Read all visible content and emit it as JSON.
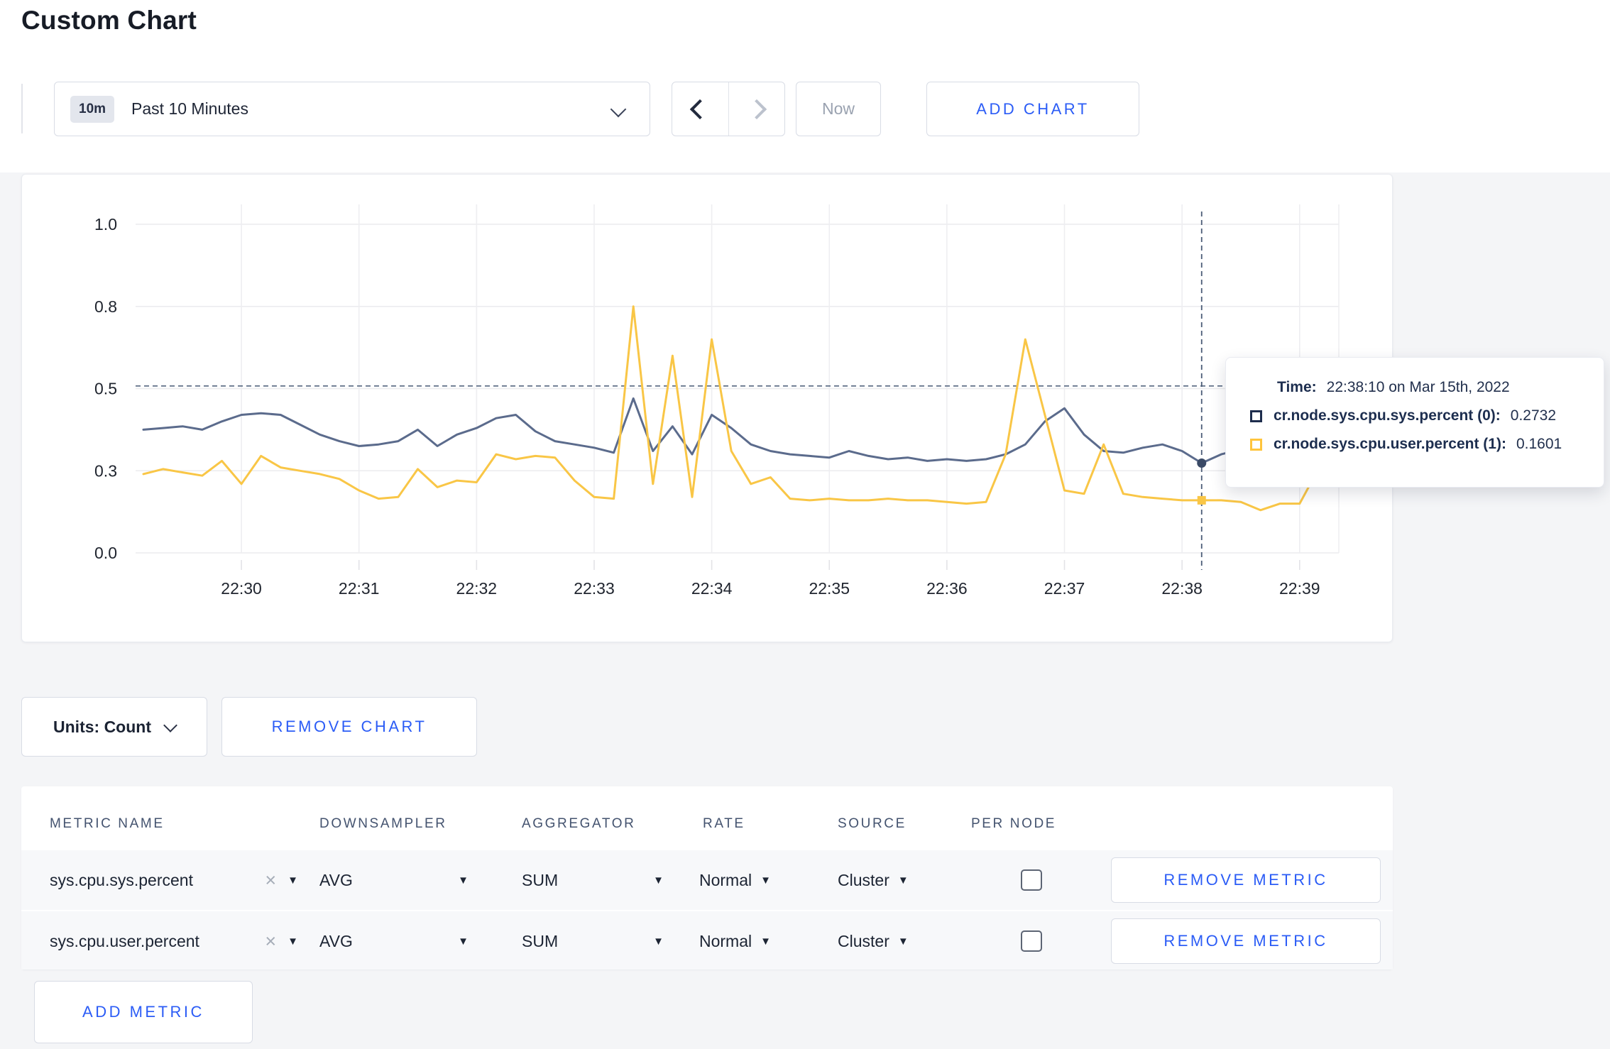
{
  "page": {
    "title": "Custom Chart"
  },
  "toolbar": {
    "time_window_badge": "10m",
    "time_window_label": "Past 10 Minutes",
    "now_label": "Now",
    "add_chart_label": "ADD CHART"
  },
  "chart_controls": {
    "units_label": "Units: Count",
    "remove_chart_label": "REMOVE CHART",
    "add_metric_label": "ADD METRIC"
  },
  "tooltip": {
    "time_label": "Time:",
    "time_value": "22:38:10 on Mar 15th, 2022",
    "series": [
      {
        "label": "cr.node.sys.cpu.sys.percent (0):",
        "value": "0.2732",
        "color": "#1e2d4d"
      },
      {
        "label": "cr.node.sys.cpu.user.percent (1):",
        "value": "0.1601",
        "color": "#ffc53d"
      }
    ]
  },
  "metrics_table": {
    "headers": [
      "METRIC NAME",
      "DOWNSAMPLER",
      "AGGREGATOR",
      "RATE",
      "SOURCE",
      "PER NODE"
    ],
    "rows": [
      {
        "metric": "sys.cpu.sys.percent",
        "downsampler": "AVG",
        "aggregator": "SUM",
        "rate": "Normal",
        "source": "Cluster",
        "per_node_checked": false,
        "remove_label": "REMOVE METRIC"
      },
      {
        "metric": "sys.cpu.user.percent",
        "downsampler": "AVG",
        "aggregator": "SUM",
        "rate": "Normal",
        "source": "Cluster",
        "per_node_checked": false,
        "remove_label": "REMOVE METRIC"
      }
    ]
  },
  "chart_data": {
    "type": "line",
    "title": "",
    "xlabel": "",
    "ylabel": "",
    "ylim": [
      0,
      1
    ],
    "grid": true,
    "legend_position": "tooltip-only",
    "y_ticks": {
      "values": [
        0,
        0.25,
        0.5,
        0.75,
        1
      ],
      "labels": [
        "0.0",
        "0.3",
        "0.5",
        "0.8",
        "1.0"
      ]
    },
    "x_ticks": [
      "22:30",
      "22:31",
      "22:32",
      "22:33",
      "22:34",
      "22:35",
      "22:36",
      "22:37",
      "22:38",
      "22:39"
    ],
    "time_domain": {
      "start_offset_s": 4,
      "sample_interval_s": 10,
      "domain_s": 614,
      "tick_first_s": 54,
      "tick_interval_s": 60
    },
    "series": [
      {
        "name": "cr.node.sys.cpu.sys.percent (0)",
        "color": "#5b6b8c",
        "values": [
          0.375,
          0.38,
          0.385,
          0.375,
          0.4,
          0.42,
          0.425,
          0.42,
          0.39,
          0.36,
          0.34,
          0.325,
          0.33,
          0.34,
          0.375,
          0.325,
          0.36,
          0.38,
          0.41,
          0.42,
          0.37,
          0.34,
          0.33,
          0.32,
          0.305,
          0.47,
          0.31,
          0.385,
          0.3,
          0.42,
          0.38,
          0.33,
          0.31,
          0.3,
          0.295,
          0.29,
          0.31,
          0.295,
          0.285,
          0.29,
          0.28,
          0.285,
          0.28,
          0.285,
          0.3,
          0.33,
          0.4,
          0.44,
          0.36,
          0.31,
          0.305,
          0.32,
          0.33,
          0.31,
          0.2732,
          0.3,
          0.315,
          0.32,
          0.3,
          0.295,
          0.3,
          0.31
        ]
      },
      {
        "name": "cr.node.sys.cpu.user.percent (1)",
        "color": "#f9c646",
        "values": [
          0.24,
          0.255,
          0.245,
          0.235,
          0.28,
          0.21,
          0.295,
          0.26,
          0.25,
          0.24,
          0.225,
          0.19,
          0.165,
          0.17,
          0.255,
          0.2,
          0.22,
          0.215,
          0.3,
          0.285,
          0.295,
          0.29,
          0.22,
          0.17,
          0.165,
          0.75,
          0.21,
          0.6,
          0.17,
          0.65,
          0.31,
          0.21,
          0.23,
          0.165,
          0.16,
          0.165,
          0.16,
          0.16,
          0.165,
          0.16,
          0.16,
          0.155,
          0.15,
          0.155,
          0.3,
          0.65,
          0.42,
          0.19,
          0.18,
          0.33,
          0.18,
          0.17,
          0.165,
          0.16,
          0.1601,
          0.16,
          0.155,
          0.13,
          0.15,
          0.15,
          0.26,
          0.28
        ]
      }
    ],
    "crosshair": {
      "time_label": "22:38:10",
      "t_s": 544,
      "h_value": 0.508,
      "markers": [
        {
          "value": 0.2732,
          "shape": "circle",
          "color": "#3a4a66"
        },
        {
          "value": 0.1601,
          "shape": "square",
          "color": "#f9c646"
        }
      ]
    }
  }
}
